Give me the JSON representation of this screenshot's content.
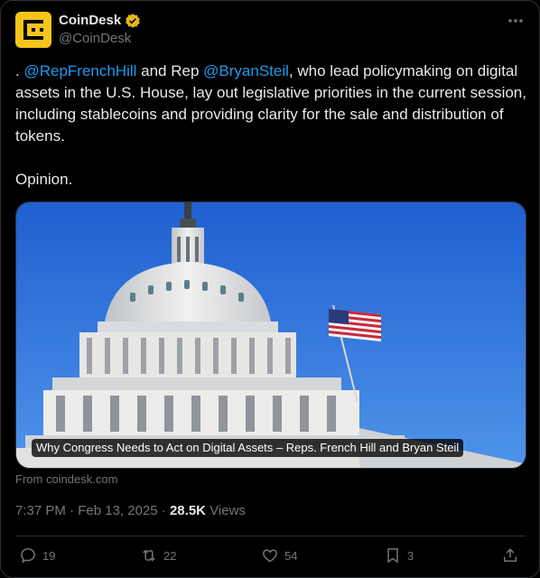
{
  "author": {
    "display_name": "CoinDesk",
    "handle": "@CoinDesk",
    "verified_icon": "gold-verified-badge",
    "brand_color": "#f5c51a"
  },
  "tweet": {
    "text_parts": {
      "lead": ". ",
      "mention1": "@RepFrenchHill",
      "mid": " and Rep ",
      "mention2": "@BryanSteil",
      "rest": ", who lead policymaking on digital assets in the U.S. House, lay out legislative priorities in the current session, including stablecoins and providing clarity for the sale and distribution of tokens.",
      "opinion": "Opinion."
    },
    "link_color": "#1d9bf0"
  },
  "card": {
    "caption": "Why Congress Needs to Act on Digital Assets – Reps. French Hill and Bryan Steil",
    "source": "From coindesk.com"
  },
  "meta": {
    "time": "7:37 PM",
    "separator": " · ",
    "date": "Feb 13, 2025",
    "views_count": "28.5K",
    "views_label": " Views"
  },
  "actions": {
    "replies": "19",
    "reposts": "22",
    "likes": "54",
    "bookmarks": "3"
  }
}
